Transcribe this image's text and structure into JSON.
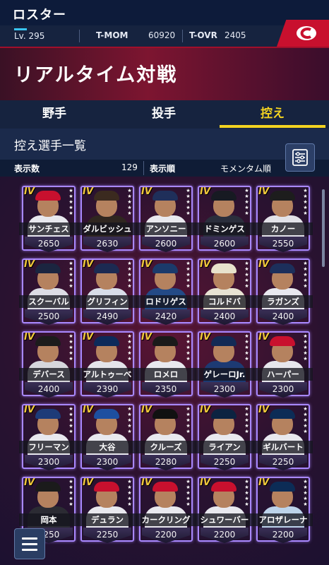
{
  "header": {
    "title": "ロスター"
  },
  "status": {
    "level": "Lv. 295",
    "tmom_label": "T-MOM",
    "tmom_value": "60920",
    "tovr_label": "T-OVR",
    "tovr_value": "2405"
  },
  "colors": {
    "accent": "#f3d321",
    "team": "#c8102e",
    "card_border": "#a988ff"
  },
  "mode": {
    "title": "リアルタイム対戦"
  },
  "tabs": [
    {
      "label": "野手",
      "active": false
    },
    {
      "label": "投手",
      "active": false
    },
    {
      "label": "控え",
      "active": true
    }
  ],
  "list": {
    "title": "控え選手一覧",
    "count_label": "表示数",
    "count_value": "129",
    "sort_label": "表示順",
    "sort_value": "モメンタム順"
  },
  "icons": {
    "filter": "filter-settings-icon",
    "menu": "hamburger-menu-icon",
    "team_logo": "team-c-logo"
  },
  "players": [
    {
      "grade": "IV",
      "name": "サンチェス",
      "ovr": "2650",
      "cap": "#c8102e",
      "body": "#e8e8ee"
    },
    {
      "grade": "IV",
      "name": "ダルビッシュ",
      "ovr": "2630",
      "cap": "#3b2a1f",
      "body": "#2f2620"
    },
    {
      "grade": "IV",
      "name": "アンソニー",
      "ovr": "2600",
      "cap": "#1f2f5a",
      "body": "#e9e9ef"
    },
    {
      "grade": "IV",
      "name": "ドミンゲス",
      "ovr": "2600",
      "cap": "#171a22",
      "body": "#2a2e3c"
    },
    {
      "grade": "IV",
      "name": "カノー",
      "ovr": "2550",
      "cap": "#1d1d1d",
      "body": "#e2e2e8"
    },
    {
      "grade": "IV",
      "name": "スクーバル",
      "ovr": "2500",
      "cap": "#1b2540",
      "body": "#dcdce4"
    },
    {
      "grade": "IV",
      "name": "グリフィン",
      "ovr": "2490",
      "cap": "#1c2a52",
      "body": "#d8dde8"
    },
    {
      "grade": "IV",
      "name": "ロドリゲス",
      "ovr": "2420",
      "cap": "#1b3a6b",
      "body": "#234a86"
    },
    {
      "grade": "IV",
      "name": "コルドバ",
      "ovr": "2400",
      "cap": "#e8e2cc",
      "body": "#e7e2d2"
    },
    {
      "grade": "IV",
      "name": "ラガンズ",
      "ovr": "2400",
      "cap": "#1c2f5b",
      "body": "#e8e8ee"
    },
    {
      "grade": "IV",
      "name": "デバース",
      "ovr": "2400",
      "cap": "#1c1c1c",
      "body": "#d6d6dc"
    },
    {
      "grade": "IV",
      "name": "アルトゥーベ",
      "ovr": "2390",
      "cap": "#0d2a5a",
      "body": "#e4e4ea"
    },
    {
      "grade": "IV",
      "name": "ロメロ",
      "ovr": "2350",
      "cap": "#1a1a1a",
      "body": "#e8e8ee"
    },
    {
      "grade": "IV",
      "name": "ゲレーロJr.",
      "ovr": "2300",
      "cap": "#132a55",
      "body": "#1d3a73"
    },
    {
      "grade": "IV",
      "name": "ハーパー",
      "ovr": "2300",
      "cap": "#c8102e",
      "body": "#e6e6ec"
    },
    {
      "grade": "IV",
      "name": "フリーマン",
      "ovr": "2300",
      "cap": "#1d3b78",
      "body": "#e8e8ee"
    },
    {
      "grade": "IV",
      "name": "大谷",
      "ovr": "2300",
      "cap": "#1d4fa0",
      "body": "#e8e8ee"
    },
    {
      "grade": "IV",
      "name": "クルーズ",
      "ovr": "2280",
      "cap": "#111",
      "body": "#e8e8ee"
    },
    {
      "grade": "IV",
      "name": "ライアン",
      "ovr": "2250",
      "cap": "#0c2341",
      "body": "#e8e8ee"
    },
    {
      "grade": "IV",
      "name": "ギルバート",
      "ovr": "2250",
      "cap": "#0c2c56",
      "body": "#e8e8ee"
    },
    {
      "grade": "IV",
      "name": "岡本",
      "ovr": "2250",
      "cap": "#1b1b1b",
      "body": "#2b2b33"
    },
    {
      "grade": "IV",
      "name": "デュラン",
      "ovr": "2250",
      "cap": "#c8102e",
      "body": "#e8e8ee"
    },
    {
      "grade": "IV",
      "name": "カークリング",
      "ovr": "2200",
      "cap": "#c8102e",
      "body": "#e8e8ee"
    },
    {
      "grade": "IV",
      "name": "シュワーバー",
      "ovr": "2200",
      "cap": "#c8102e",
      "body": "#e8e8ee"
    },
    {
      "grade": "IV",
      "name": "アロザレーナ",
      "ovr": "2200",
      "cap": "#0c2c56",
      "body": "#bcd3ea"
    }
  ]
}
